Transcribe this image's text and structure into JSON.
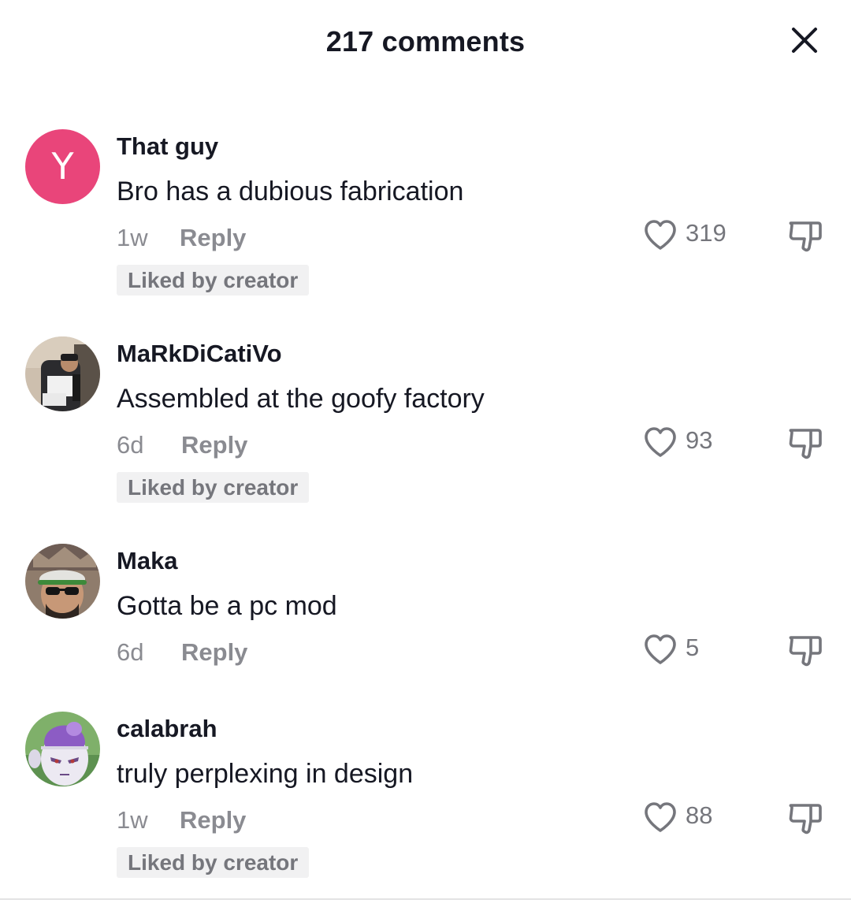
{
  "header": {
    "title": "217 comments",
    "close_icon": "close-icon"
  },
  "colors": {
    "text_primary": "#161823",
    "text_secondary": "#8a8b91",
    "badge_bg": "#f1f1f2",
    "avatar_letter_bg": "#e9457a"
  },
  "comments": [
    {
      "avatar_letter": "Y",
      "username": "That guy",
      "text": "Bro has a dubious fabrication",
      "time": "1w",
      "reply_label": "Reply",
      "likes": "319",
      "liked_by_creator": "Liked by creator"
    },
    {
      "username": "MaRkDiCatiVo",
      "text": "Assembled at the goofy factory",
      "time": "6d",
      "reply_label": "Reply",
      "likes": "93",
      "liked_by_creator": "Liked by creator"
    },
    {
      "username": "Maka",
      "text": "Gotta be a pc mod",
      "time": "6d",
      "reply_label": "Reply",
      "likes": "5"
    },
    {
      "username": "calabrah",
      "text": "truly perplexing in design",
      "time": "1w",
      "reply_label": "Reply",
      "likes": "88",
      "liked_by_creator": "Liked by creator"
    }
  ]
}
